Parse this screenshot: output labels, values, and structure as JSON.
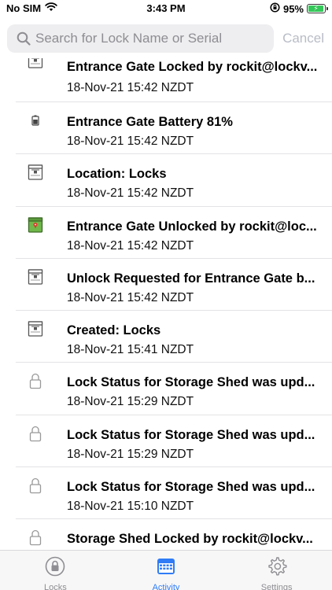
{
  "status_bar": {
    "carrier": "No SIM",
    "time": "3:43 PM",
    "battery": "95%",
    "battery_level": 0.95
  },
  "search": {
    "placeholder": "Search for Lock Name or Serial",
    "value": "",
    "cancel_label": "Cancel"
  },
  "activity": [
    {
      "icon": "gate-icon",
      "title": "Entrance Gate Locked by rockit@lockv...",
      "time": "18-Nov-21 15:42 NZDT"
    },
    {
      "icon": "battery-icon",
      "title": "Entrance Gate Battery 81%",
      "time": "18-Nov-21 15:42 NZDT"
    },
    {
      "icon": "gate-icon",
      "title": "Location: Locks",
      "time": "18-Nov-21 15:42 NZDT"
    },
    {
      "icon": "gate-unlocked-icon",
      "title": "Entrance Gate Unlocked by rockit@loc...",
      "time": "18-Nov-21 15:42 NZDT"
    },
    {
      "icon": "gate-icon",
      "title": "Unlock Requested for Entrance Gate b...",
      "time": "18-Nov-21 15:42 NZDT"
    },
    {
      "icon": "gate-icon",
      "title": "Created: Locks",
      "time": "18-Nov-21 15:41 NZDT"
    },
    {
      "icon": "padlock-icon",
      "title": "Lock Status for Storage Shed was upd...",
      "time": "18-Nov-21 15:29 NZDT"
    },
    {
      "icon": "padlock-icon",
      "title": "Lock Status for Storage Shed was upd...",
      "time": "18-Nov-21 15:29 NZDT"
    },
    {
      "icon": "padlock-icon",
      "title": "Lock Status for Storage Shed was upd...",
      "time": "18-Nov-21 15:10 NZDT"
    },
    {
      "icon": "padlock-icon",
      "title": "Storage Shed Locked by rockit@lockv...",
      "time": ""
    }
  ],
  "tabs": [
    {
      "label": "Locks",
      "icon": "lock-circle-icon",
      "active": false
    },
    {
      "label": "Activity",
      "icon": "calendar-icon",
      "active": true
    },
    {
      "label": "Settings",
      "icon": "gear-icon",
      "active": false
    }
  ],
  "colors": {
    "accent": "#2f7cf6",
    "inactive": "#8e8e93",
    "unlocked_green": "#6fb84a"
  }
}
